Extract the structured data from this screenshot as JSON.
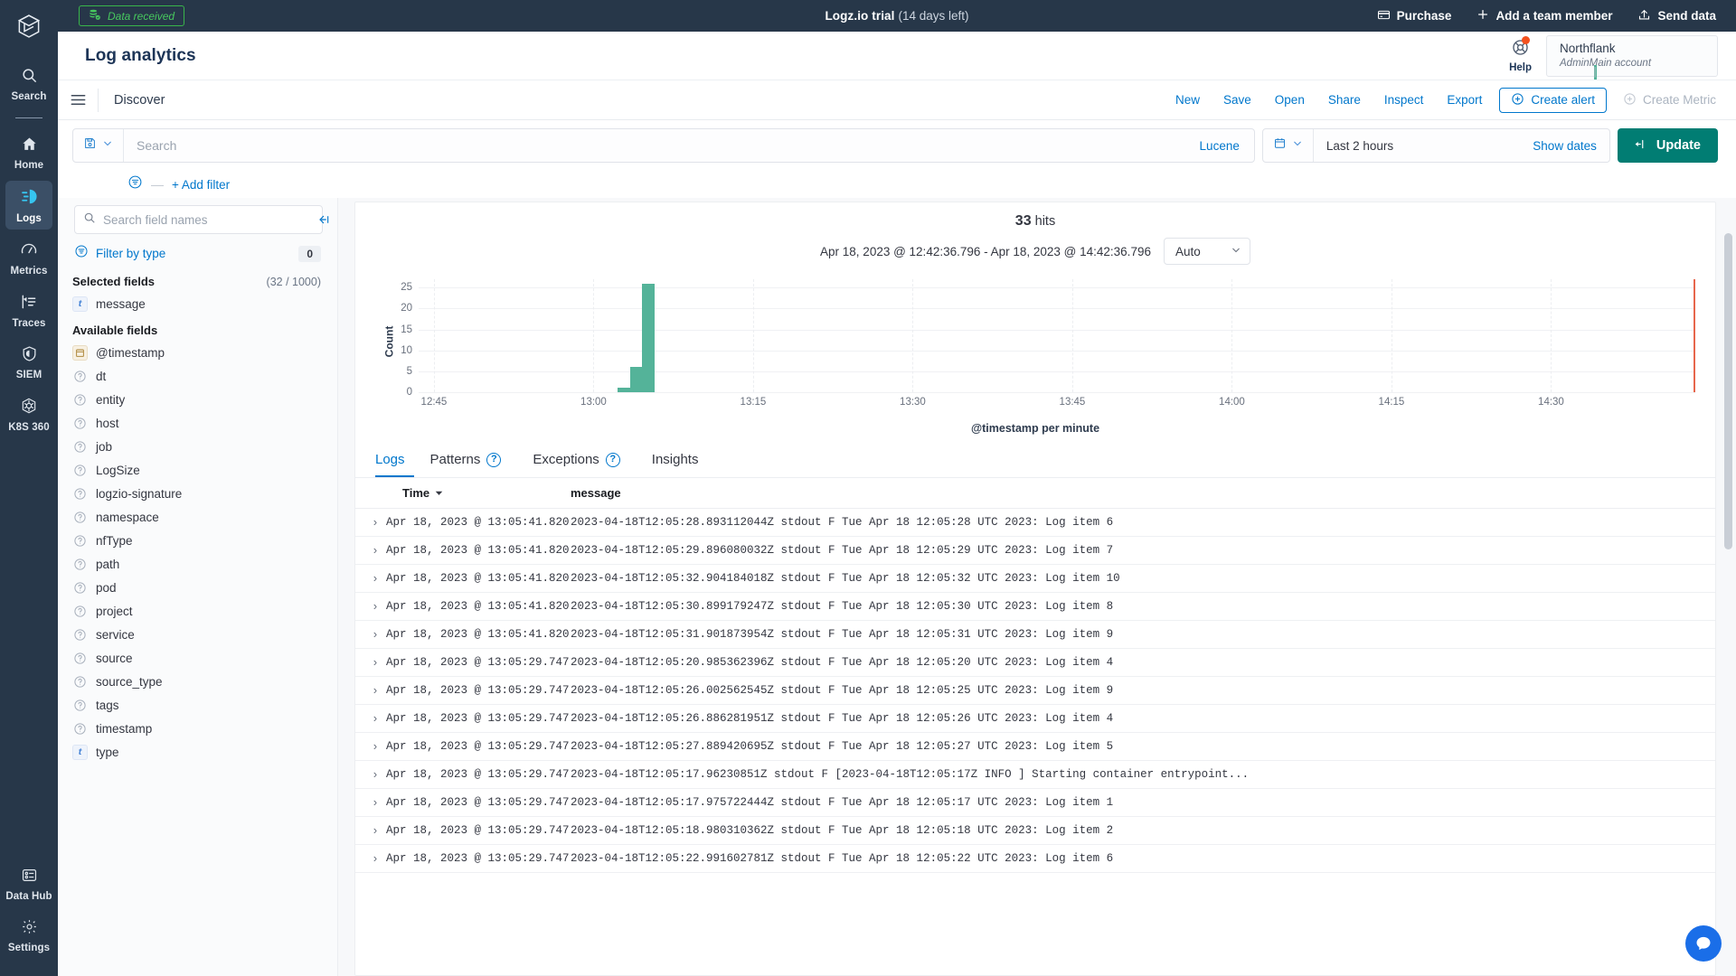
{
  "topbar": {
    "data_received_label": "Data received",
    "trial_title": "Logz.io trial",
    "trial_note": "(14 days left)",
    "actions": [
      {
        "label": "Purchase",
        "icon": "credit-card-icon"
      },
      {
        "label": "Add a team member",
        "icon": "plus-icon"
      },
      {
        "label": "Send data",
        "icon": "upload-icon"
      }
    ]
  },
  "rail": {
    "logo": "logzio-logo-icon",
    "top": [
      {
        "label": "Search",
        "icon": "search-icon",
        "active": false
      }
    ],
    "items": [
      {
        "label": "Home",
        "icon": "home-icon",
        "active": false
      },
      {
        "label": "Logs",
        "icon": "logs-icon",
        "active": true
      },
      {
        "label": "Metrics",
        "icon": "metrics-gauge-icon",
        "active": false
      },
      {
        "label": "Traces",
        "icon": "traces-icon",
        "active": false
      },
      {
        "label": "SIEM",
        "icon": "shield-icon",
        "active": false
      },
      {
        "label": "K8S 360",
        "icon": "kubernetes-icon",
        "active": false
      }
    ],
    "bottom": [
      {
        "label": "Data Hub",
        "icon": "data-hub-icon"
      },
      {
        "label": "Settings",
        "icon": "gear-icon"
      }
    ]
  },
  "appheader": {
    "title": "Log analytics",
    "help_label": "Help",
    "help_icon": "lifebuoy-icon",
    "account_name": "Northflank",
    "account_role": "Admin",
    "account_scope": "Main account"
  },
  "discoverbar": {
    "menu_icon": "hamburger-icon",
    "title": "Discover",
    "links": [
      "New",
      "Save",
      "Open",
      "Share",
      "Inspect",
      "Export"
    ],
    "create_alert_label": "Create alert",
    "create_metric_label": "Create Metric"
  },
  "querybar": {
    "saved_query_icon": "save-disk-icon",
    "search_placeholder": "Search",
    "search_value": "",
    "language_label": "Lucene",
    "calendar_icon": "calendar-icon",
    "date_range_label": "Last 2 hours",
    "show_dates_label": "Show dates",
    "update_label": "Update",
    "update_icon": "refresh-icon",
    "update_color": "#017d73"
  },
  "filterbar": {
    "filter_icon": "filter-icon",
    "add_filter_label": "+ Add filter"
  },
  "fieldpanel": {
    "search_placeholder": "Search field names",
    "search_value": "",
    "filter_by_type_label": "Filter by type",
    "filter_by_type_count": "0",
    "collapse_icon": "collapse-panel-icon",
    "selected_title": "Selected fields",
    "selected_count": "(32 / 1000)",
    "selected_fields": [
      {
        "name": "message",
        "type": "t"
      }
    ],
    "available_title": "Available fields",
    "available_fields": [
      {
        "name": "@timestamp",
        "type": "date"
      },
      {
        "name": "dt",
        "type": "unknown"
      },
      {
        "name": "entity",
        "type": "unknown"
      },
      {
        "name": "host",
        "type": "unknown"
      },
      {
        "name": "job",
        "type": "unknown"
      },
      {
        "name": "LogSize",
        "type": "unknown"
      },
      {
        "name": "logzio-signature",
        "type": "unknown"
      },
      {
        "name": "namespace",
        "type": "unknown"
      },
      {
        "name": "nfType",
        "type": "unknown"
      },
      {
        "name": "path",
        "type": "unknown"
      },
      {
        "name": "pod",
        "type": "unknown"
      },
      {
        "name": "project",
        "type": "unknown"
      },
      {
        "name": "service",
        "type": "unknown"
      },
      {
        "name": "source",
        "type": "unknown"
      },
      {
        "name": "source_type",
        "type": "unknown"
      },
      {
        "name": "tags",
        "type": "unknown"
      },
      {
        "name": "timestamp",
        "type": "unknown"
      },
      {
        "name": "type",
        "type": "t"
      }
    ]
  },
  "main": {
    "hits_count": "33",
    "hits_label": "hits",
    "time_range": "Apr 18, 2023 @ 12:42:36.796 - Apr 18, 2023 @ 14:42:36.796",
    "interval_value": "Auto",
    "tabs": [
      {
        "label": "Logs",
        "help": false,
        "active": true
      },
      {
        "label": "Patterns",
        "help": true,
        "active": false
      },
      {
        "label": "Exceptions",
        "help": true,
        "active": false
      },
      {
        "label": "Insights",
        "help": false,
        "active": false
      }
    ],
    "columns": {
      "time": "Time",
      "message": "message",
      "sort_icon": "sort-desc-icon"
    },
    "rows": [
      {
        "time": "Apr 18, 2023 @ 13:05:41.820",
        "message": "2023-04-18T12:05:28.893112044Z stdout F Tue Apr 18 12:05:28 UTC 2023: Log item 6"
      },
      {
        "time": "Apr 18, 2023 @ 13:05:41.820",
        "message": "2023-04-18T12:05:29.896080032Z stdout F Tue Apr 18 12:05:29 UTC 2023: Log item 7"
      },
      {
        "time": "Apr 18, 2023 @ 13:05:41.820",
        "message": "2023-04-18T12:05:32.904184018Z stdout F Tue Apr 18 12:05:32 UTC 2023: Log item 10"
      },
      {
        "time": "Apr 18, 2023 @ 13:05:41.820",
        "message": "2023-04-18T12:05:30.899179247Z stdout F Tue Apr 18 12:05:30 UTC 2023: Log item 8"
      },
      {
        "time": "Apr 18, 2023 @ 13:05:41.820",
        "message": "2023-04-18T12:05:31.901873954Z stdout F Tue Apr 18 12:05:31 UTC 2023: Log item 9"
      },
      {
        "time": "Apr 18, 2023 @ 13:05:29.747",
        "message": "2023-04-18T12:05:20.985362396Z stdout F Tue Apr 18 12:05:20 UTC 2023: Log item 4"
      },
      {
        "time": "Apr 18, 2023 @ 13:05:29.747",
        "message": "2023-04-18T12:05:26.002562545Z stdout F Tue Apr 18 12:05:25 UTC 2023: Log item 9"
      },
      {
        "time": "Apr 18, 2023 @ 13:05:29.747",
        "message": "2023-04-18T12:05:26.886281951Z stdout F Tue Apr 18 12:05:26 UTC 2023: Log item 4"
      },
      {
        "time": "Apr 18, 2023 @ 13:05:29.747",
        "message": "2023-04-18T12:05:27.889420695Z stdout F Tue Apr 18 12:05:27 UTC 2023: Log item 5"
      },
      {
        "time": "Apr 18, 2023 @ 13:05:29.747",
        "message": "2023-04-18T12:05:17.96230851Z stdout F [2023-04-18T12:05:17Z INFO ] Starting container entrypoint..."
      },
      {
        "time": "Apr 18, 2023 @ 13:05:29.747",
        "message": "2023-04-18T12:05:17.975722444Z stdout F Tue Apr 18 12:05:17 UTC 2023: Log item 1"
      },
      {
        "time": "Apr 18, 2023 @ 13:05:29.747",
        "message": "2023-04-18T12:05:18.980310362Z stdout F Tue Apr 18 12:05:18 UTC 2023: Log item 2"
      },
      {
        "time": "Apr 18, 2023 @ 13:05:29.747",
        "message": "2023-04-18T12:05:22.991602781Z stdout F Tue Apr 18 12:05:22 UTC 2023: Log item 6"
      }
    ]
  },
  "chart_data": {
    "type": "bar",
    "title": "33 hits",
    "subtitle": "Apr 18, 2023 @ 12:42:36.796 - Apr 18, 2023 @ 14:42:36.796",
    "xlabel": "@timestamp per minute",
    "ylabel": "Count",
    "ylim": [
      0,
      27
    ],
    "yticks": [
      0,
      5,
      10,
      15,
      20,
      25
    ],
    "xticks": [
      "12:45",
      "13:00",
      "13:15",
      "13:30",
      "13:45",
      "14:00",
      "14:15",
      "14:30"
    ],
    "grid": true,
    "legend": "none",
    "bar_color": "#54b399",
    "marker_color": "#e7664c",
    "marker_label": "now",
    "x": [
      "13:04",
      "13:05",
      "13:06"
    ],
    "values": [
      1,
      6,
      26
    ],
    "x_positions_pct": [
      15.6,
      16.55,
      17.5
    ]
  },
  "chat": {
    "icon": "chat-bubble-icon",
    "color": "#1a6ee8"
  }
}
